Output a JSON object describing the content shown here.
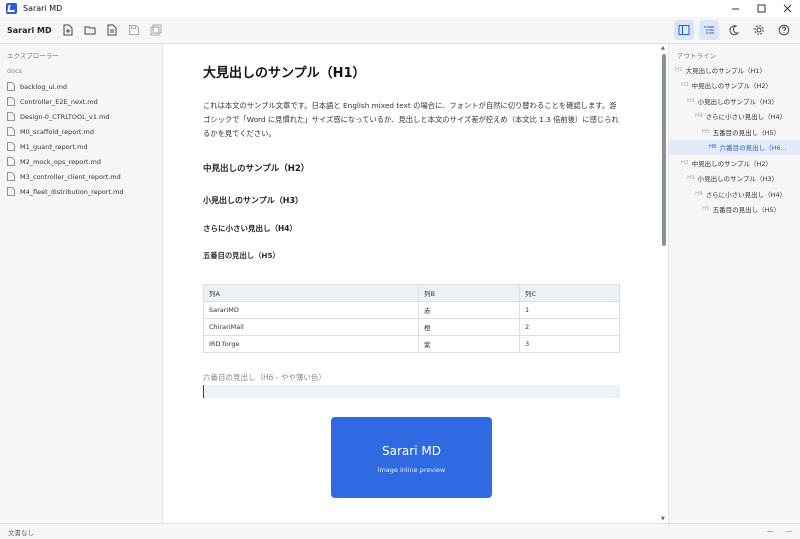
{
  "window": {
    "title": "Sarari MD"
  },
  "toolbar": {
    "app_name": "Sarari MD"
  },
  "sidebar": {
    "header": "エクスプローラー",
    "folder": "docs",
    "files": [
      "backlog_ui.md",
      "Controller_E2E_next.md",
      "Design-0_CTRLTOOL_v1.md",
      "M0_scaffold_report.md",
      "M1_guard_report.md",
      "M2_mock_ops_report.md",
      "M3_controller_client_report.md",
      "M4_fleet_distribution_report.md"
    ]
  },
  "editor": {
    "h1": "大見出しのサンプル（H1）",
    "paragraph": "これは本文のサンプル文章です。日本語と English mixed text の場合に、フォントが自然に切り替わることを確認します。游ゴシックで「Word に見慣れた」サイズ感になっているか、見出しと本文のサイズ差が控えめ（本文比 1.3 倍前後）に感じられるかを見てください。",
    "h2": "中見出しのサンプル（H2）",
    "h3": "小見出しのサンプル（H3）",
    "h4": "さらに小さい見出し（H4）",
    "h5": "五番目の見出し（H5）",
    "table": {
      "headers": [
        "列A",
        "列B",
        "列C"
      ],
      "rows": [
        [
          "SarariMD",
          "赤",
          "1"
        ],
        [
          "ChirariMail",
          "橙",
          "2"
        ],
        [
          "IRD forge",
          "紫",
          "3"
        ]
      ]
    },
    "h6": "六番目の見出し（H6 - やや薄い色）",
    "image": {
      "title": "Sarari MD",
      "subtitle": "image inline preview",
      "color": "#2f6ae3"
    }
  },
  "outline": {
    "header": "アウトライン",
    "items": [
      {
        "level": "H1",
        "text": "大見出しのサンプル（H1）",
        "active": false
      },
      {
        "level": "H2",
        "text": "中見出しのサンプル（H2）",
        "active": false
      },
      {
        "level": "H3",
        "text": "小見出しのサンプル（H3）",
        "active": false
      },
      {
        "level": "H4",
        "text": "さらに小さい見出し（H4）",
        "active": false
      },
      {
        "level": "H5",
        "text": "五番目の見出し（H5）",
        "active": false
      },
      {
        "level": "H6",
        "text": "六番目の見出し（H6...",
        "active": true
      },
      {
        "level": "H2",
        "text": "中見出しのサンプル（H2）",
        "active": false
      },
      {
        "level": "H3",
        "text": "小見出しのサンプル（H3）",
        "active": false
      },
      {
        "level": "H4",
        "text": "さらに小さい見出し（H4）",
        "active": false
      },
      {
        "level": "H5",
        "text": "五番目の見出し（H5）",
        "active": false
      }
    ]
  },
  "statusbar": {
    "left": "文書なし",
    "right_a": "—",
    "right_b": "—"
  },
  "colors": {
    "accent": "#2b5cd6",
    "active_bg": "#e3ebfb"
  }
}
